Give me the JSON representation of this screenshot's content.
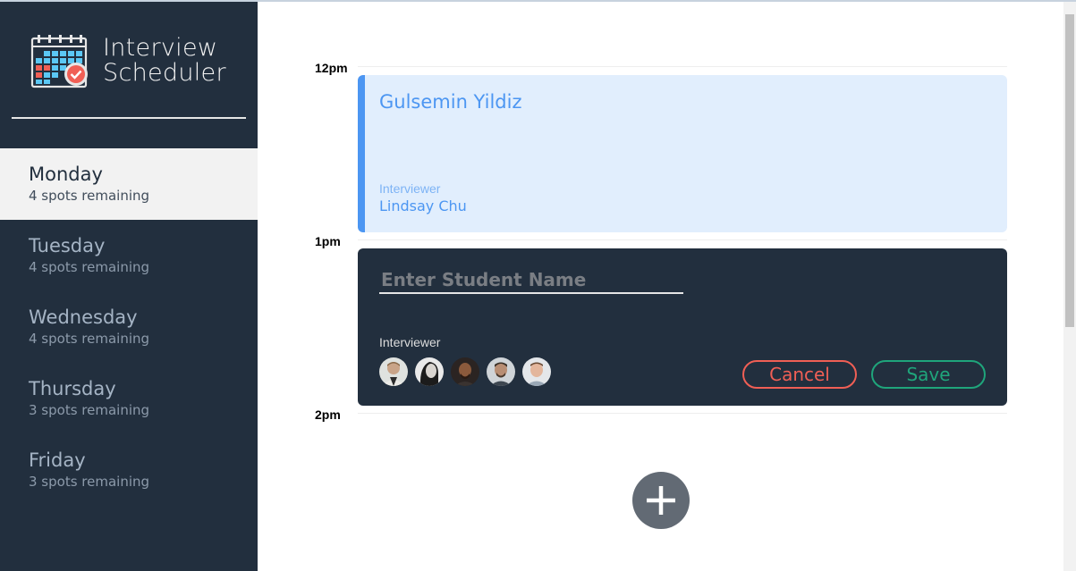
{
  "app": {
    "title_line1": "Interview",
    "title_line2": "Scheduler",
    "logo_icon": "calendar-check-icon"
  },
  "sidebar": {
    "days": [
      {
        "name": "Monday",
        "spots": "4 spots remaining",
        "selected": true
      },
      {
        "name": "Tuesday",
        "spots": "4 spots remaining",
        "selected": false
      },
      {
        "name": "Wednesday",
        "spots": "4 spots remaining",
        "selected": false
      },
      {
        "name": "Thursday",
        "spots": "3 spots remaining",
        "selected": false
      },
      {
        "name": "Friday",
        "spots": "3 spots remaining",
        "selected": false
      }
    ]
  },
  "schedule": {
    "times": [
      "12pm",
      "1pm",
      "2pm"
    ],
    "booked": {
      "student": "Gulsemin Yildiz",
      "interviewer_label": "Interviewer",
      "interviewer": "Lindsay Chu"
    },
    "form": {
      "placeholder": "Enter Student Name",
      "interviewer_label": "Interviewer",
      "interviewer_avatar_count": 5,
      "cancel_label": "Cancel",
      "save_label": "Save"
    },
    "add_icon": "plus-icon"
  },
  "colors": {
    "sidebar_bg": "#222f3e",
    "booked_bg": "#e1eefd",
    "booked_accent": "#4c96f2",
    "cancel": "#f05f55",
    "save": "#1fa57b",
    "add_button": "#626a74"
  }
}
